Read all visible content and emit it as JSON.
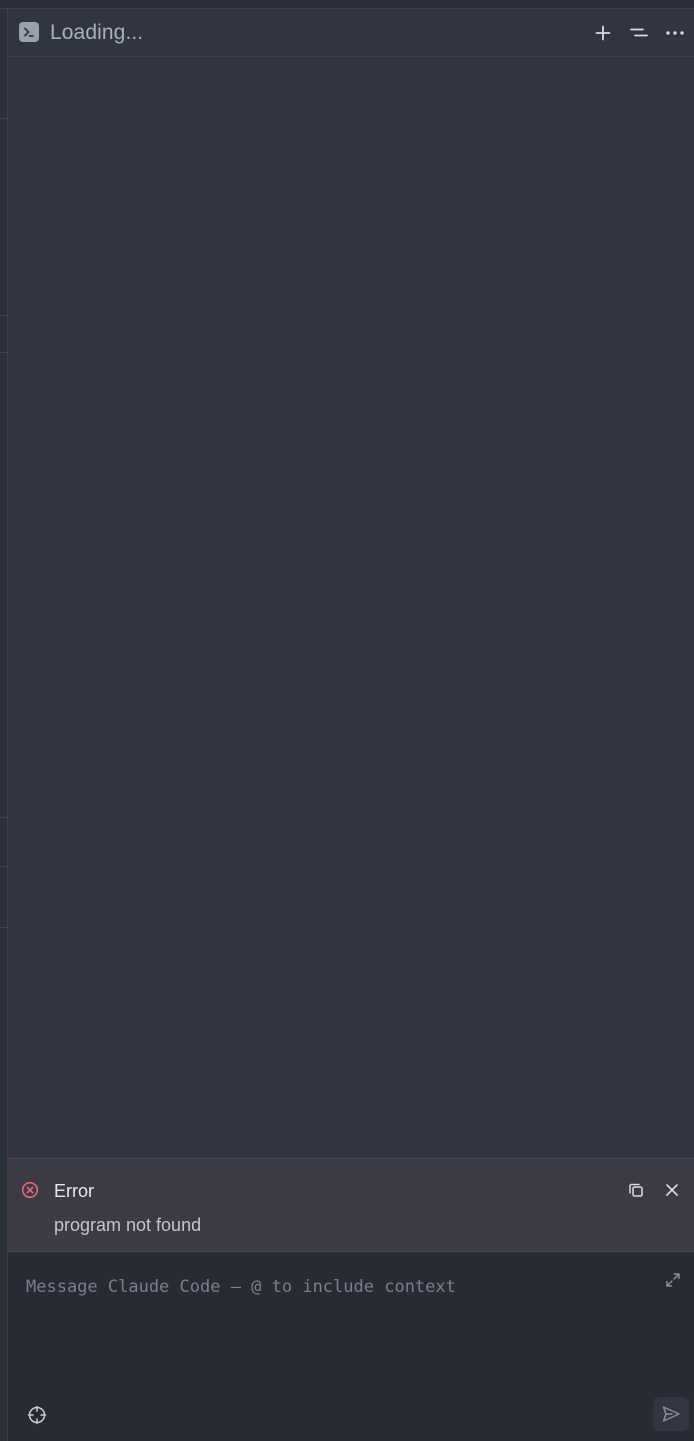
{
  "header": {
    "title": "Loading...",
    "icon": "terminal-icon",
    "actions": [
      {
        "name": "new-tab-button",
        "icon": "plus-icon"
      },
      {
        "name": "tab-list-button",
        "icon": "list-icon"
      },
      {
        "name": "more-button",
        "icon": "more-horizontal-icon"
      }
    ]
  },
  "error": {
    "title": "Error",
    "message": "program not found",
    "icon": "error-circle-icon",
    "accent_color": "#e06c75"
  },
  "composer": {
    "placeholder": "Message Claude Code — @ to include context",
    "value": ""
  },
  "colors": {
    "panel_bg": "#313540",
    "error_bg": "#3c3a45",
    "composer_bg": "#282b33"
  }
}
